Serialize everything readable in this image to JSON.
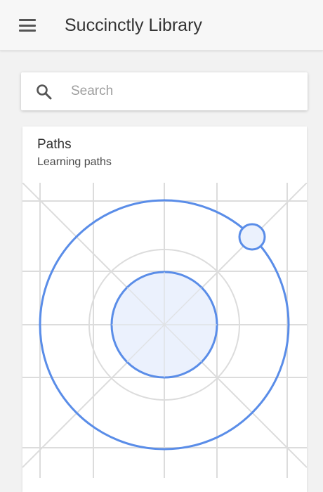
{
  "app_bar": {
    "title": "Succinctly Library",
    "menu_icon": "hamburger-menu-icon"
  },
  "search": {
    "placeholder": "Search",
    "value": "",
    "icon": "search-icon"
  },
  "card": {
    "title": "Paths",
    "subtitle": "Learning paths",
    "illustration": "orbit-logo-illustration"
  },
  "colors": {
    "accent": "#5a8de8",
    "accent_fill": "#ebf1fd",
    "grid": "#dcdcdc",
    "app_bar_bg": "#f7f7f7",
    "page_bg": "#f2f2f2"
  }
}
